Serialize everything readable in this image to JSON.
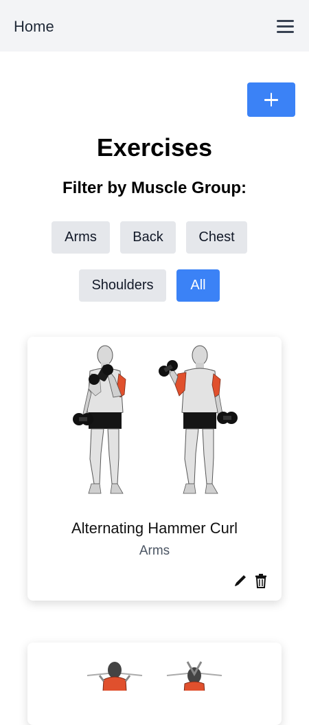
{
  "nav": {
    "home_label": "Home",
    "menu_icon": "hamburger-menu-icon"
  },
  "toolbar": {
    "add_icon": "plus-icon"
  },
  "page": {
    "title": "Exercises",
    "filter_heading": "Filter by Muscle Group:"
  },
  "filters": [
    {
      "label": "Arms",
      "active": false
    },
    {
      "label": "Back",
      "active": false
    },
    {
      "label": "Chest",
      "active": false
    },
    {
      "label": "Shoulders",
      "active": false
    },
    {
      "label": "All",
      "active": true
    }
  ],
  "exercises": [
    {
      "name": "Alternating Hammer Curl",
      "muscle_group": "Arms",
      "image_icon": "hammer-curl-illustration",
      "edit_icon": "pencil-icon",
      "delete_icon": "trash-icon"
    },
    {
      "name": "",
      "muscle_group": "",
      "image_icon": "back-exercise-illustration"
    }
  ],
  "colors": {
    "accent": "#3b82f6",
    "nav_bg": "#f3f4f6",
    "chip_bg": "#e5e7eb",
    "muscle_highlight": "#e0502d"
  }
}
